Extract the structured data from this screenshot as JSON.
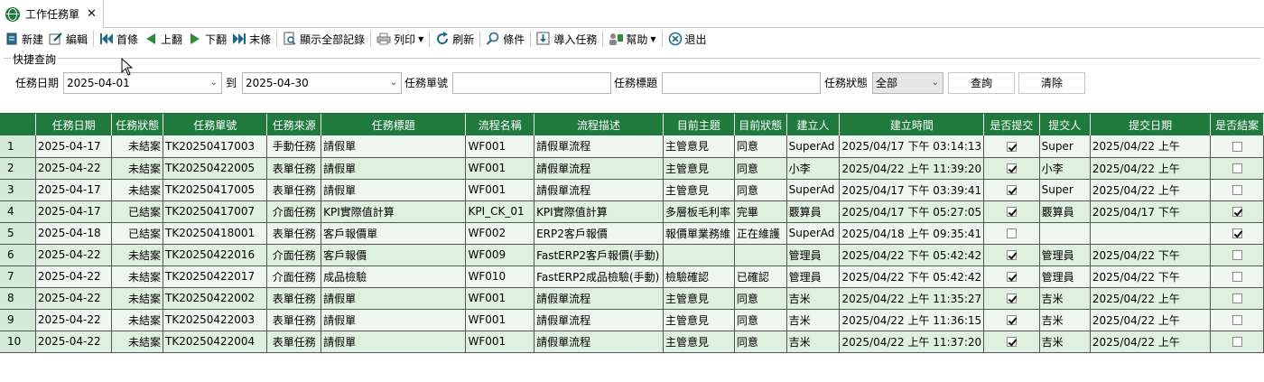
{
  "tab": {
    "title": "工作任務單",
    "icon": "globe-icon",
    "close_icon": "close-icon"
  },
  "toolbar": {
    "new": "新建",
    "edit": "編輯",
    "first": "首條",
    "prev": "上翻",
    "next": "下翻",
    "last": "末條",
    "show_all": "顯示全部記錄",
    "print": "列印",
    "refresh": "刷新",
    "condition": "條件",
    "import": "導入任務",
    "help": "幫助",
    "exit": "退出"
  },
  "quick_query": {
    "legend": "快捷查詢",
    "date_label": "任務日期",
    "date_from": "2025-04-01",
    "to_label": "到",
    "date_to": "2025-04-30",
    "task_no_label": "任務單號",
    "task_no_value": "",
    "task_title_label": "任務標題",
    "task_title_value": "",
    "status_label": "任務狀態",
    "status_value": "全部",
    "query_button": "查詢",
    "clear_button": "清除"
  },
  "colors": {
    "header_bg": "#207a3e",
    "row_odd": "#eef7ee",
    "row_even": "#dff0df"
  },
  "grid": {
    "columns": [
      "任務日期",
      "任務狀態",
      "任務單號",
      "任務來源",
      "任務標題",
      "流程名稱",
      "流程描述",
      "目前主題",
      "目前狀態",
      "建立人",
      "建立時間",
      "是否提交",
      "提交人",
      "提交日期",
      "是否結案"
    ],
    "rows": [
      {
        "n": "1",
        "date": "2025-04-17",
        "status": "未結案",
        "no": "TK20250417003",
        "source": "手動任務",
        "title": "請假單",
        "flow": "WF001",
        "desc": "請假單流程",
        "topic": "主管意見",
        "cstatus": "同意",
        "creator": "SuperAd",
        "ctime": "2025/04/17 下午 03:14:13",
        "submitted": true,
        "submitter": "Super",
        "sdate": "2025/04/22 上午",
        "closed": false
      },
      {
        "n": "2",
        "date": "2025-04-22",
        "status": "未結案",
        "no": "TK20250422005",
        "source": "表單任務",
        "title": "請假單",
        "flow": "WF001",
        "desc": "請假單流程",
        "topic": "主管意見",
        "cstatus": "同意",
        "creator": "小李",
        "ctime": "2025/04/22 上午 11:39:20",
        "submitted": true,
        "submitter": "小李",
        "sdate": "2025/04/22 上午",
        "closed": false
      },
      {
        "n": "3",
        "date": "2025-04-17",
        "status": "未結案",
        "no": "TK20250417005",
        "source": "表單任務",
        "title": "請假單",
        "flow": "WF001",
        "desc": "請假單流程",
        "topic": "主管意見",
        "cstatus": "同意",
        "creator": "SuperAd",
        "ctime": "2025/04/17 下午 03:39:41",
        "submitted": true,
        "submitter": "Super",
        "sdate": "2025/04/22 上午",
        "closed": false
      },
      {
        "n": "4",
        "date": "2025-04-17",
        "status": "已結案",
        "no": "TK20250417007",
        "source": "介面任務",
        "title": "KPI實際值計算",
        "flow": "KPI_CK_01",
        "desc": "KPI實際值計算",
        "topic": "多層板毛利率",
        "cstatus": "完畢",
        "creator": "覈算員",
        "ctime": "2025/04/17 下午 05:27:05",
        "submitted": true,
        "submitter": "覈算員",
        "sdate": "2025/04/17 下午",
        "closed": true
      },
      {
        "n": "5",
        "date": "2025-04-18",
        "status": "已結案",
        "no": "TK20250418001",
        "source": "表單任務",
        "title": "客戶報價單",
        "flow": "WF002",
        "desc": "ERP2客戶報價",
        "topic": "報價單業務維",
        "cstatus": "正在維護",
        "creator": "SuperAd",
        "ctime": "2025/04/18 上午 09:35:41",
        "submitted": false,
        "submitter": "",
        "sdate": "",
        "closed": true
      },
      {
        "n": "6",
        "date": "2025-04-22",
        "status": "未結案",
        "no": "TK20250422016",
        "source": "介面任務",
        "title": "客戶報價",
        "flow": "WF009",
        "desc": "FastERP2客戶報價(手動)",
        "topic": "",
        "cstatus": "",
        "creator": "管理員",
        "ctime": "2025/04/22 下午 05:42:42",
        "submitted": true,
        "submitter": "管理員",
        "sdate": "2025/04/22 下午",
        "closed": false
      },
      {
        "n": "7",
        "date": "2025-04-22",
        "status": "未結案",
        "no": "TK20250422017",
        "source": "介面任務",
        "title": "成品檢驗",
        "flow": "WF010",
        "desc": "FastERP2成品檢驗(手動)",
        "topic": "檢驗確認",
        "cstatus": "已確認",
        "creator": "管理員",
        "ctime": "2025/04/22 下午 05:42:42",
        "submitted": true,
        "submitter": "管理員",
        "sdate": "2025/04/22 下午",
        "closed": false
      },
      {
        "n": "8",
        "date": "2025-04-22",
        "status": "未結案",
        "no": "TK20250422002",
        "source": "表單任務",
        "title": "請假單",
        "flow": "WF001",
        "desc": "請假單流程",
        "topic": "主管意見",
        "cstatus": "同意",
        "creator": "吉米",
        "ctime": "2025/04/22 上午 11:35:27",
        "submitted": true,
        "submitter": "吉米",
        "sdate": "2025/04/22 上午",
        "closed": false
      },
      {
        "n": "9",
        "date": "2025-04-22",
        "status": "未結案",
        "no": "TK20250422003",
        "source": "表單任務",
        "title": "請假單",
        "flow": "WF001",
        "desc": "請假單流程",
        "topic": "主管意見",
        "cstatus": "同意",
        "creator": "吉米",
        "ctime": "2025/04/22 上午 11:36:15",
        "submitted": true,
        "submitter": "吉米",
        "sdate": "2025/04/22 上午",
        "closed": false
      },
      {
        "n": "10",
        "date": "2025-04-22",
        "status": "未結案",
        "no": "TK20250422004",
        "source": "表單任務",
        "title": "請假單",
        "flow": "WF001",
        "desc": "請假單流程",
        "topic": "主管意見",
        "cstatus": "同意",
        "creator": "吉米",
        "ctime": "2025/04/22 上午 11:37:20",
        "submitted": true,
        "submitter": "吉米",
        "sdate": "2025/04/22 上午",
        "closed": false
      }
    ]
  }
}
